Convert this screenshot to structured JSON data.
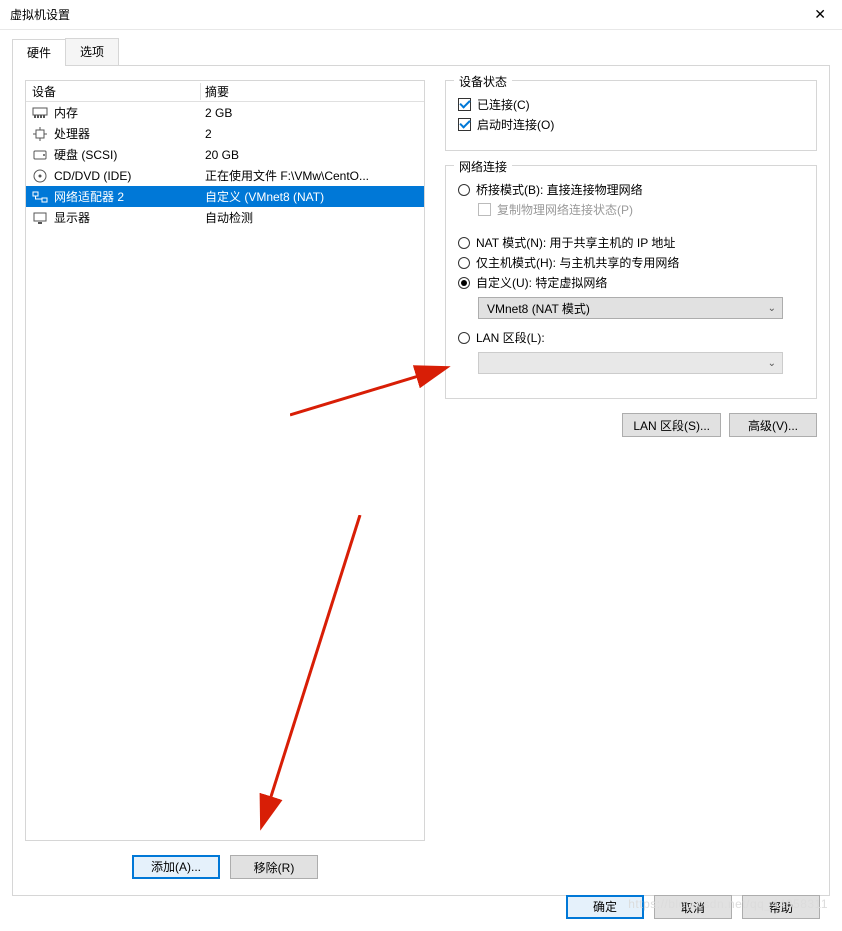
{
  "title": "虚拟机设置",
  "tabs": {
    "hardware": "硬件",
    "options": "选项"
  },
  "devlist": {
    "col_device": "设备",
    "col_summary": "摘要",
    "rows": [
      {
        "name": "内存",
        "summary": "2 GB"
      },
      {
        "name": "处理器",
        "summary": "2"
      },
      {
        "name": "硬盘 (SCSI)",
        "summary": "20 GB"
      },
      {
        "name": "CD/DVD (IDE)",
        "summary": "正在使用文件 F:\\VMw\\CentO..."
      },
      {
        "name": "网络适配器 2",
        "summary": "自定义 (VMnet8 (NAT)"
      },
      {
        "name": "显示器",
        "summary": "自动检测"
      }
    ]
  },
  "left_buttons": {
    "add": "添加(A)...",
    "remove": "移除(R)"
  },
  "status_group": {
    "legend": "设备状态",
    "connected": "已连接(C)",
    "connect_on_start": "启动时连接(O)"
  },
  "network_group": {
    "legend": "网络连接",
    "bridged": "桥接模式(B): 直接连接物理网络",
    "replicate": "复制物理网络连接状态(P)",
    "nat": "NAT 模式(N): 用于共享主机的 IP 地址",
    "hostonly": "仅主机模式(H): 与主机共享的专用网络",
    "custom": "自定义(U): 特定虚拟网络",
    "custom_value": "VMnet8 (NAT 模式)",
    "lan": "LAN 区段(L):"
  },
  "right_buttons": {
    "lanseg": "LAN 区段(S)...",
    "advanced": "高级(V)..."
  },
  "footer": {
    "ok": "确定",
    "cancel": "取消",
    "help": "帮助"
  },
  "watermark": "https://blog.csdn.net/qq_44858311"
}
